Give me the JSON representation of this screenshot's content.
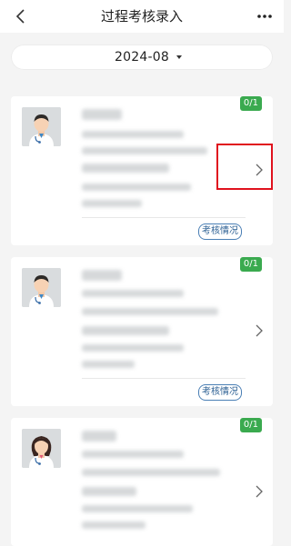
{
  "header": {
    "title": "过程考核录入",
    "back_icon": "chevron-left-icon",
    "more_icon": "more-dots-icon"
  },
  "filter": {
    "date_label": "2024-08",
    "dropdown_icon": "caret-down-icon"
  },
  "records": [
    {
      "badge": "0/1",
      "avatar": "male-doctor",
      "status_button": "考核情况"
    },
    {
      "badge": "0/1",
      "avatar": "male-doctor",
      "status_button": "考核情况"
    },
    {
      "badge": "0/1",
      "avatar": "female-doctor"
    }
  ],
  "colors": {
    "badge_green": "#3aaa4f",
    "highlight_red": "#e0121e",
    "status_blue": "#4a7fb5"
  }
}
